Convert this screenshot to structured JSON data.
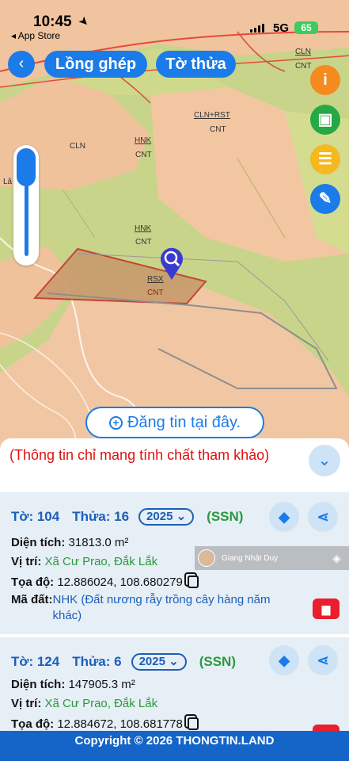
{
  "status": {
    "time": "10:45",
    "back_app": "◂ App Store",
    "network": "5G",
    "battery": "65"
  },
  "nav": {
    "back_icon": "‹",
    "tab_overlay": "Lồng ghép",
    "tab_parcel": "Tờ thửa"
  },
  "map_labels": [
    "CLN",
    "CNT",
    "CLN+RST",
    "CNT",
    "HNK",
    "CNT",
    "CLN",
    "HNK",
    "CNT",
    "RSX",
    "CNT",
    "Lâ"
  ],
  "fabs": [
    {
      "icon": "info-icon",
      "glyph": "i",
      "color": "#f58a1f"
    },
    {
      "icon": "save-icon",
      "glyph": "▣",
      "color": "#26a845"
    },
    {
      "icon": "list-icon",
      "glyph": "☰",
      "color": "#f5b81f"
    },
    {
      "icon": "edit-icon",
      "glyph": "✎",
      "color": "#1b7be9"
    }
  ],
  "post_button": {
    "label": "Đăng tin tại đây."
  },
  "info_note": "(Thông tin chỉ mang tính chất tham khảo)",
  "overlay_user": "Giang Nhật Duy",
  "cards": [
    {
      "sheet_label": "Tờ: 104",
      "parcel_label": "Thửa: 16",
      "year": "2025",
      "source": "(SSN)",
      "area_label": "Diện tích:",
      "area_value": "31813.0 m²",
      "location_label": "Vị trí:",
      "location_value": "Xã Cư Prao, Đắk Lắk",
      "coords_label": "Tọa độ:",
      "coords_value": "12.886024, 108.680279",
      "landcode_label": "Mã đất:",
      "landcode_value": "NHK (Đất nương rẫy trồng cây hàng năm khác)"
    },
    {
      "sheet_label": "Tờ: 124",
      "parcel_label": "Thửa: 6",
      "year": "2025",
      "source": "(SSN)",
      "area_label": "Diện tích:",
      "area_value": "147905.3 m²",
      "location_label": "Vị trí:",
      "location_value": "Xã Cư Prao, Đắk Lắk",
      "coords_label": "Tọa độ:",
      "coords_value": "12.884672, 108.681778"
    }
  ],
  "footer": "Copyright © 2026 THONGTIN.LAND",
  "colors": {
    "accent": "#1b7be9",
    "green_text": "#2a9a3c",
    "danger": "#ea1f2d",
    "map_green": "#c4d47c",
    "map_orange": "#f3c29a"
  }
}
